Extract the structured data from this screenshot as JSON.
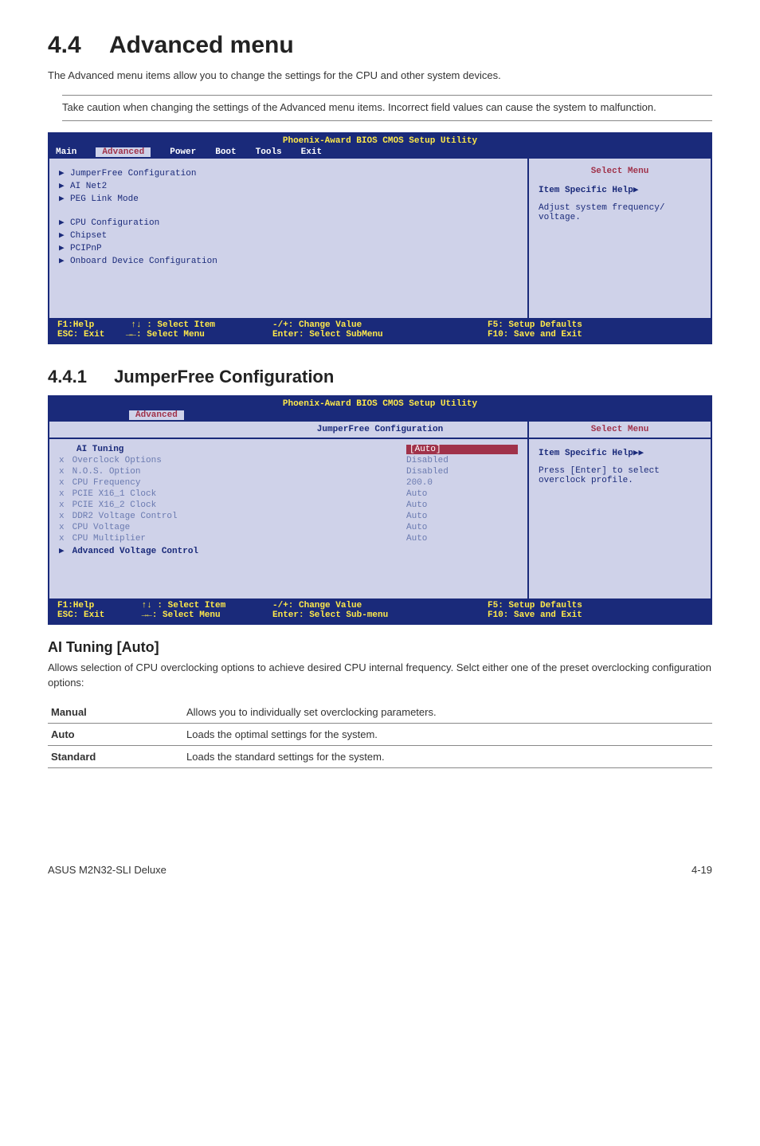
{
  "h1_num": "4.4",
  "h1_title": "Advanced menu",
  "h1_desc": "The Advanced menu items allow you to change the settings for the CPU and other system devices.",
  "note_text": "Take caution when changing the settings of the Advanced menu items. Incorrect field values can cause the system to malfunction.",
  "bios": {
    "title": "Phoenix-Award BIOS CMOS Setup Utility",
    "tabs": [
      "Main",
      "Advanced",
      "Power",
      "Boot",
      "Tools",
      "Exit"
    ],
    "items": [
      "JumperFree Configuration",
      "AI Net2",
      "PEG Link Mode",
      "",
      "CPU Configuration",
      "Chipset",
      "PCIPnP",
      "Onboard Device Configuration"
    ],
    "select_menu": "Select Menu",
    "help_label": "Item Specific Help▶",
    "help_text": "Adjust system frequency/ voltage.",
    "footer1a": "F1:Help       ↑↓ : Select Item",
    "footer1b": "-/+: Change Value",
    "footer1c": "F5: Setup Defaults",
    "footer2a": "ESC: Exit    →←: Select Menu",
    "footer2b": "Enter: Select SubMenu",
    "footer2c": "F10: Save and Exit"
  },
  "h2_num": "4.4.1",
  "h2_title": "JumperFree Configuration",
  "bios2": {
    "title": "Phoenix-Award BIOS CMOS Setup Utility",
    "tab": "Advanced",
    "section": "JumperFree Configuration",
    "select_menu": "Select Menu",
    "help_label": "Item Specific Help▶▶",
    "help_text": "Press [Enter] to select overclock profile.",
    "rows": [
      {
        "k": "AI Tuning",
        "v": "[Auto]",
        "hi": true
      },
      {
        "k": "Overclock Options",
        "v": "Disabled",
        "dis": true
      },
      {
        "k": "N.O.S. Option",
        "v": "Disabled",
        "dis": true
      },
      {
        "k": "CPU Frequency",
        "v": "200.0",
        "dis": true
      },
      {
        "k": "PCIE X16_1 Clock",
        "v": "Auto",
        "dis": true
      },
      {
        "k": "PCIE X16_2 Clock",
        "v": "Auto",
        "dis": true
      },
      {
        "k": "DDR2 Voltage Control",
        "v": "Auto",
        "dis": true
      },
      {
        "k": "CPU Voltage",
        "v": "Auto",
        "dis": true
      },
      {
        "k": "CPU Multiplier",
        "v": "Auto",
        "dis": true
      },
      {
        "k": "Advanced Voltage Control",
        "v": "",
        "tri": true
      }
    ],
    "footer1a": "F1:Help         ↑↓ : Select Item",
    "footer1b": "-/+: Change Value",
    "footer1c": "F5: Setup Defaults",
    "footer2a": "ESC: Exit       →←: Select Menu",
    "footer2b": "Enter: Select Sub-menu",
    "footer2c": "F10: Save and Exit"
  },
  "ai_heading": "AI Tuning [Auto]",
  "ai_desc": "Allows selection of CPU overclocking options to achieve desired CPU internal frequency. Selct either one of the preset overclocking configuration options:",
  "params": [
    {
      "label": "Manual",
      "text": "Allows you to individually set overclocking parameters."
    },
    {
      "label": "Auto",
      "text": "Loads the optimal settings for the system."
    },
    {
      "label": "Standard",
      "text": "Loads the standard settings for the system."
    }
  ],
  "footer_left": "ASUS M2N32-SLI Deluxe",
  "footer_right": "4-19"
}
